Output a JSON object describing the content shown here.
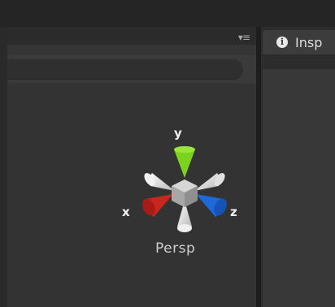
{
  "scene_view": {
    "panel_menu_icon": "panel-menu-icon",
    "gizmo": {
      "axis_labels": {
        "x": "x",
        "y": "y",
        "z": "z"
      },
      "axis_colors": {
        "x": "#c8271f",
        "y": "#7dd11f",
        "z": "#1e68d9"
      },
      "projection_label": "Persp"
    }
  },
  "inspector": {
    "tab_icon": "info-icon",
    "tab_label": "Insp"
  }
}
